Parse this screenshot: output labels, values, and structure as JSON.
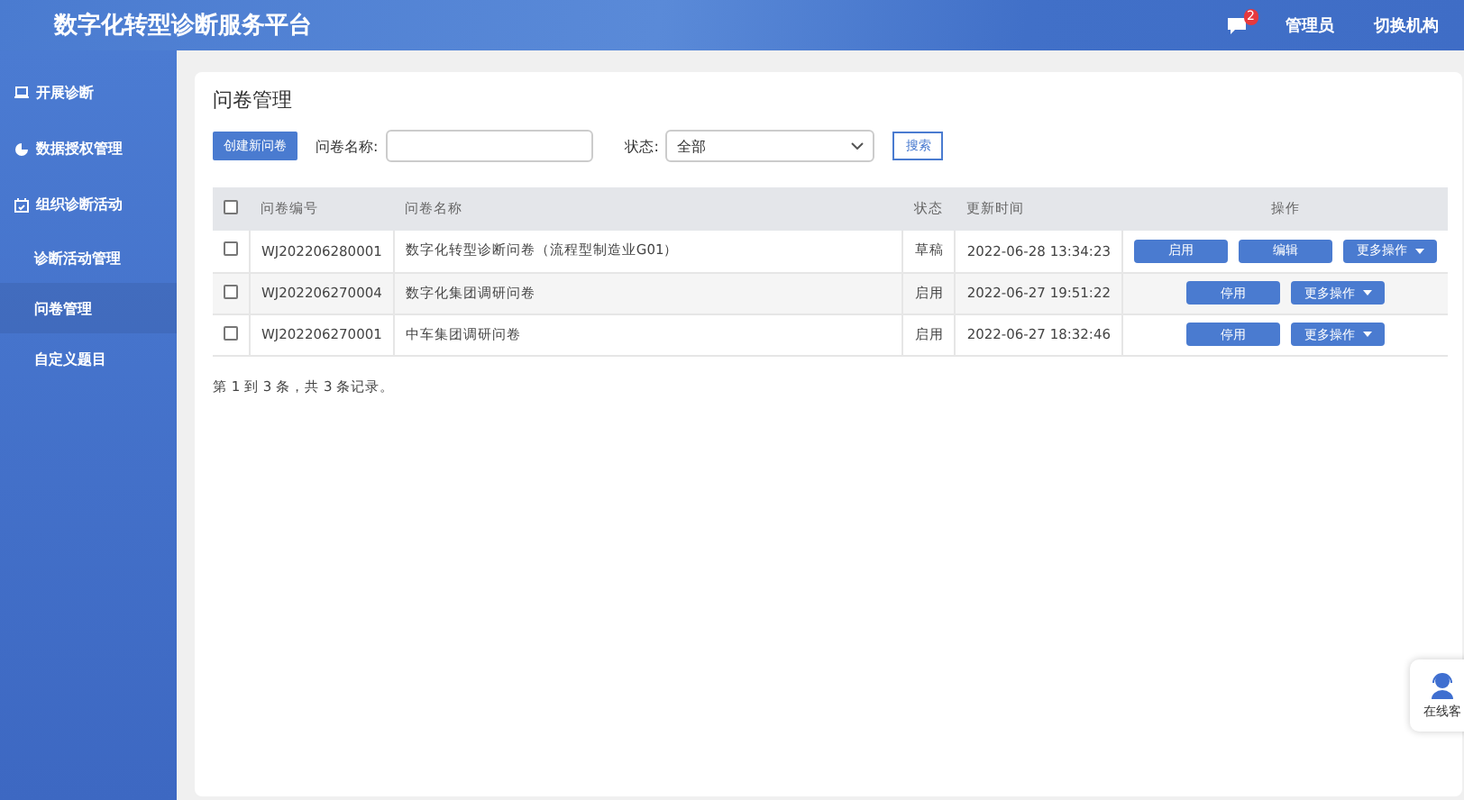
{
  "header": {
    "title": "数字化转型诊断服务平台",
    "message_badge": "2",
    "user": "管理员",
    "switch": "切换机构"
  },
  "sidebar": {
    "items": [
      {
        "label": "开展诊断",
        "selected": false
      },
      {
        "label": "数据授权管理",
        "selected": false
      },
      {
        "label": "组织诊断活动",
        "selected": false,
        "children": [
          {
            "label": "诊断活动管理",
            "selected": false
          },
          {
            "label": "问卷管理",
            "selected": true
          },
          {
            "label": "自定义题目",
            "selected": false
          }
        ]
      }
    ]
  },
  "page": {
    "title": "问卷管理",
    "create_button": "创建新问卷",
    "name_label": "问卷名称:",
    "status_label": "状态:",
    "status_value": "全部",
    "search_button": "搜索"
  },
  "table": {
    "select_all": false,
    "columns": [
      "问卷编号",
      "问卷名称",
      "状态",
      "更新时间",
      "操作"
    ],
    "rows": [
      {
        "checked": false,
        "id": "WJ202206280001",
        "name": "数字化转型诊断问卷（流程型制造业G01）",
        "status": "草稿",
        "time": "2022-06-28 13:34:23",
        "actions": [
          "启用",
          "编辑"
        ],
        "more": "更多操作"
      },
      {
        "checked": false,
        "id": "WJ202206270004",
        "name": "数字化集团调研问卷",
        "status": "启用",
        "time": "2022-06-27 19:51:22",
        "actions": [
          "停用"
        ],
        "more": "更多操作"
      },
      {
        "checked": false,
        "id": "WJ202206270001",
        "name": "中车集团调研问卷",
        "status": "启用",
        "time": "2022-06-27 18:32:46",
        "actions": [
          "停用"
        ],
        "more": "更多操作"
      }
    ]
  },
  "pagination": "第 1 到 3 条，共 3 条记录。",
  "service": {
    "label": "在线客"
  }
}
